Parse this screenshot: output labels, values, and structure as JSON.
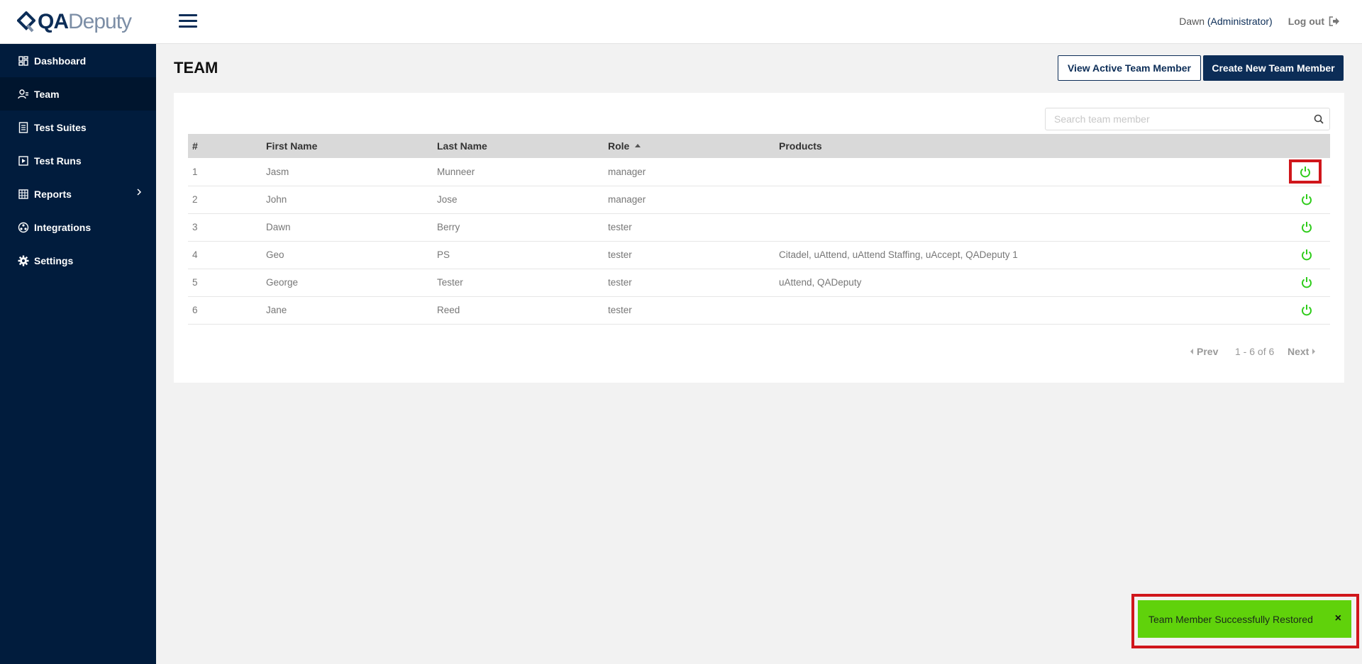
{
  "brand": {
    "part1": "QA",
    "part2": "Deputy"
  },
  "sidebar": {
    "items": [
      {
        "label": "Dashboard",
        "icon": "dashboard-icon"
      },
      {
        "label": "Team",
        "icon": "team-icon"
      },
      {
        "label": "Test Suites",
        "icon": "test-suites-icon"
      },
      {
        "label": "Test Runs",
        "icon": "test-runs-icon"
      },
      {
        "label": "Reports",
        "icon": "reports-icon"
      },
      {
        "label": "Integrations",
        "icon": "integrations-icon"
      },
      {
        "label": "Settings",
        "icon": "settings-icon"
      }
    ]
  },
  "header": {
    "user_name": "Dawn",
    "user_role": "(Administrator)",
    "logout_label": "Log out"
  },
  "page": {
    "title": "TEAM",
    "view_active_label": "View Active Team Member",
    "create_new_label": "Create New Team Member"
  },
  "search": {
    "placeholder": "Search team member"
  },
  "table": {
    "headers": {
      "num": "#",
      "first": "First Name",
      "last": "Last Name",
      "role": "Role",
      "products": "Products"
    },
    "rows": [
      {
        "num": "1",
        "first": "Jasm",
        "last": "Munneer",
        "role": "manager",
        "products": ""
      },
      {
        "num": "2",
        "first": "John",
        "last": "Jose",
        "role": "manager",
        "products": ""
      },
      {
        "num": "3",
        "first": "Dawn",
        "last": "Berry",
        "role": "tester",
        "products": ""
      },
      {
        "num": "4",
        "first": "Geo",
        "last": "PS",
        "role": "tester",
        "products": "Citadel, uAttend, uAttend Staffing, uAccept, QADeputy 1"
      },
      {
        "num": "5",
        "first": "George",
        "last": "Tester",
        "role": "tester",
        "products": "uAttend, QADeputy"
      },
      {
        "num": "6",
        "first": "Jane",
        "last": "Reed",
        "role": "tester",
        "products": ""
      }
    ]
  },
  "pagination": {
    "prev": "Prev",
    "info": "1 - 6 of 6",
    "next": "Next"
  },
  "toast": {
    "message": "Team Member Successfully Restored",
    "close": "×"
  },
  "colors": {
    "navy": "#0c2d57",
    "sidebar": "#011c3d",
    "power_green": "#2ecc1a",
    "toast_green": "#60d20b",
    "highlight_red": "#d0161b"
  }
}
